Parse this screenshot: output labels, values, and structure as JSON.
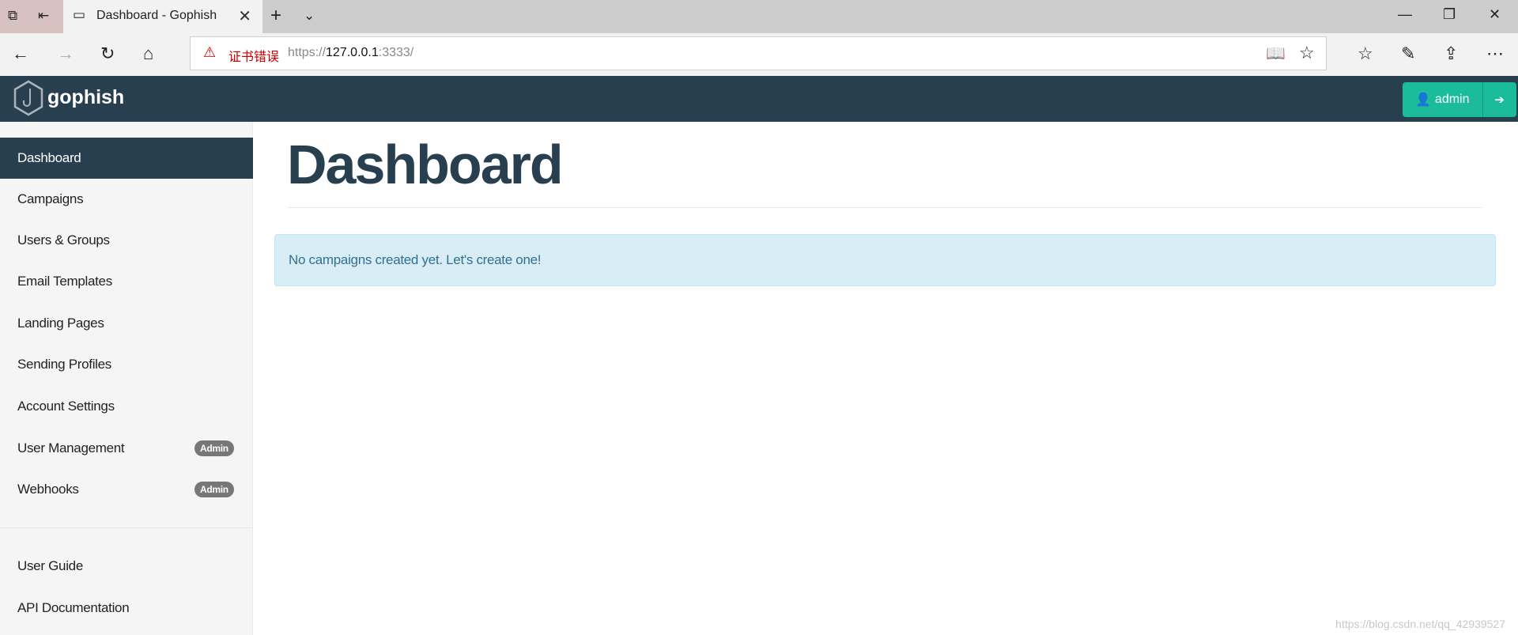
{
  "browser": {
    "tab_title": "Dashboard - Gophish",
    "cert_error": "证书错误",
    "url_scheme": "https://",
    "url_host": "127.0.0.1",
    "url_rest": ":3333/"
  },
  "navbar": {
    "brand": "gophish",
    "user_label": "admin"
  },
  "sidebar": {
    "items": [
      {
        "label": "Dashboard",
        "active": true
      },
      {
        "label": "Campaigns"
      },
      {
        "label": "Users & Groups"
      },
      {
        "label": "Email Templates"
      },
      {
        "label": "Landing Pages"
      },
      {
        "label": "Sending Profiles"
      },
      {
        "label": "Account Settings"
      },
      {
        "label": "User Management",
        "badge": "Admin"
      },
      {
        "label": "Webhooks",
        "badge": "Admin"
      }
    ],
    "footer_items": [
      {
        "label": "User Guide"
      },
      {
        "label": "API Documentation"
      }
    ]
  },
  "main": {
    "title": "Dashboard",
    "alert": "No campaigns created yet. Let's create one!"
  },
  "watermark": "https://blog.csdn.net/qq_42939527",
  "colors": {
    "navbar": "#283f50",
    "accent": "#1abc9c",
    "alert_bg": "#d9edf7"
  }
}
